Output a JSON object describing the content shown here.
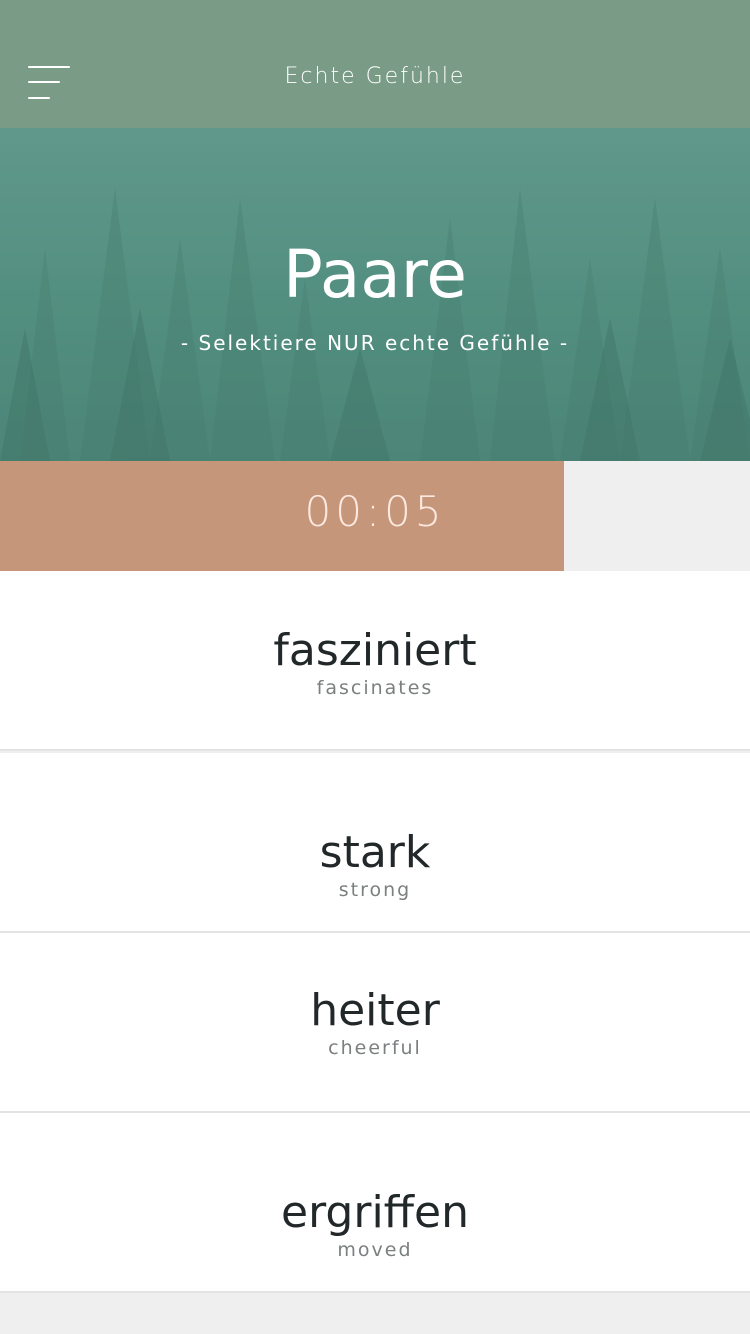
{
  "header": {
    "app_title": "Echte Gefühle",
    "menu_icon": "menu-icon"
  },
  "hero": {
    "title": "Paare",
    "subtitle": "- Selektiere NUR echte Gefühle -"
  },
  "timer": {
    "display": "00:05",
    "remaining_fraction": 0.752,
    "fill_color": "#c6967a"
  },
  "options": [
    {
      "word": "fasziniert",
      "translation": "fascinates"
    },
    {
      "word": "stark",
      "translation": "strong"
    },
    {
      "word": "heiter",
      "translation": "cheerful"
    },
    {
      "word": "ergriffen",
      "translation": "moved"
    }
  ],
  "colors": {
    "header_bg": "#7a9c87",
    "hero_bg": "#4d8b7b",
    "text_dark": "#22282a",
    "text_muted": "#7b7f80"
  }
}
